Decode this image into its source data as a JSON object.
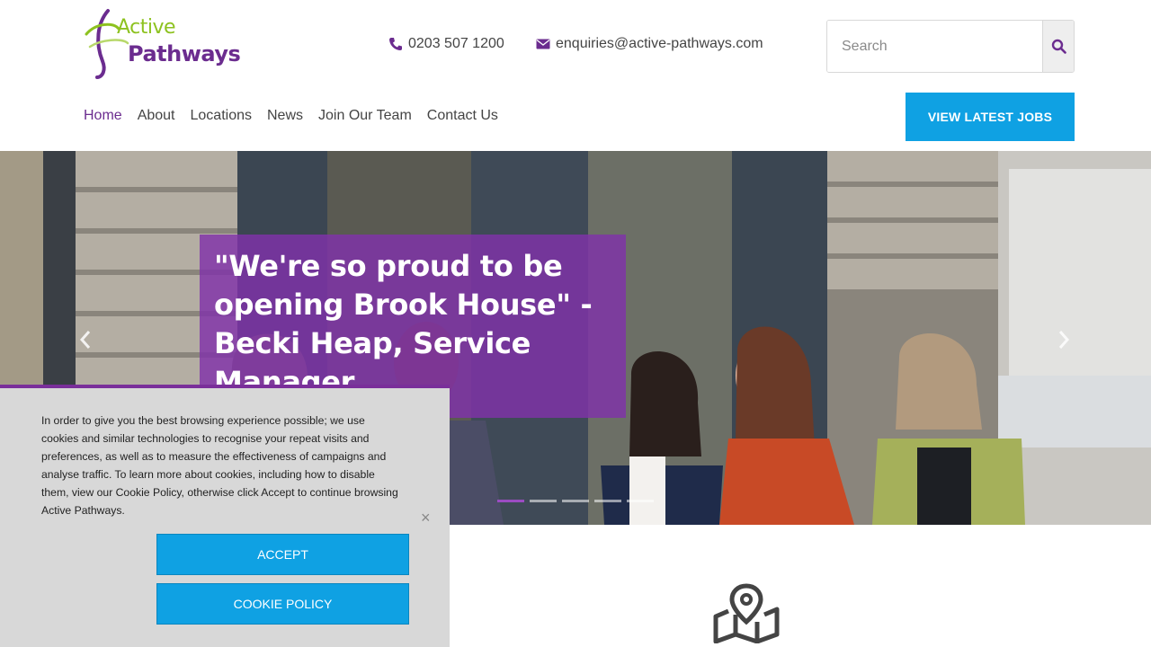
{
  "brand": {
    "line1": "Active",
    "line2": "Pathways",
    "green": "#8dc21f",
    "purple": "#6b2c8f"
  },
  "contact": {
    "phone": "0203 507 1200",
    "email": "enquiries@active-pathways.com",
    "phone_icon": "phone-icon",
    "email_icon": "envelope-icon"
  },
  "search": {
    "placeholder": "Search",
    "value": ""
  },
  "nav": [
    {
      "label": "Home",
      "active": true
    },
    {
      "label": "About"
    },
    {
      "label": "Locations"
    },
    {
      "label": "News"
    },
    {
      "label": "Join Our Team"
    },
    {
      "label": "Contact Us"
    }
  ],
  "jobs_button": "VIEW LATEST JOBS",
  "hero": {
    "caption": "\"We're so proud to be opening Brook House\" - Becki Heap, Service Manager",
    "slide_count": 5,
    "active_slide": 1,
    "accent": "#8032aa"
  },
  "cookie": {
    "text": "In order to give you the best browsing experience possible; we use cookies and similar technologies to recognise your repeat visits and preferences, as well as to measure the effectiveness of campaigns and analyse traffic. To learn more about cookies, including how to disable them, view our Cookie Policy, otherwise click Accept to continue browsing Active Pathways.",
    "close": "×",
    "accept": "ACCEPT",
    "policy": "COOKIE POLICY"
  },
  "colors": {
    "cta_blue": "#0fa1e3",
    "banner_gray": "#d8d8d8"
  }
}
